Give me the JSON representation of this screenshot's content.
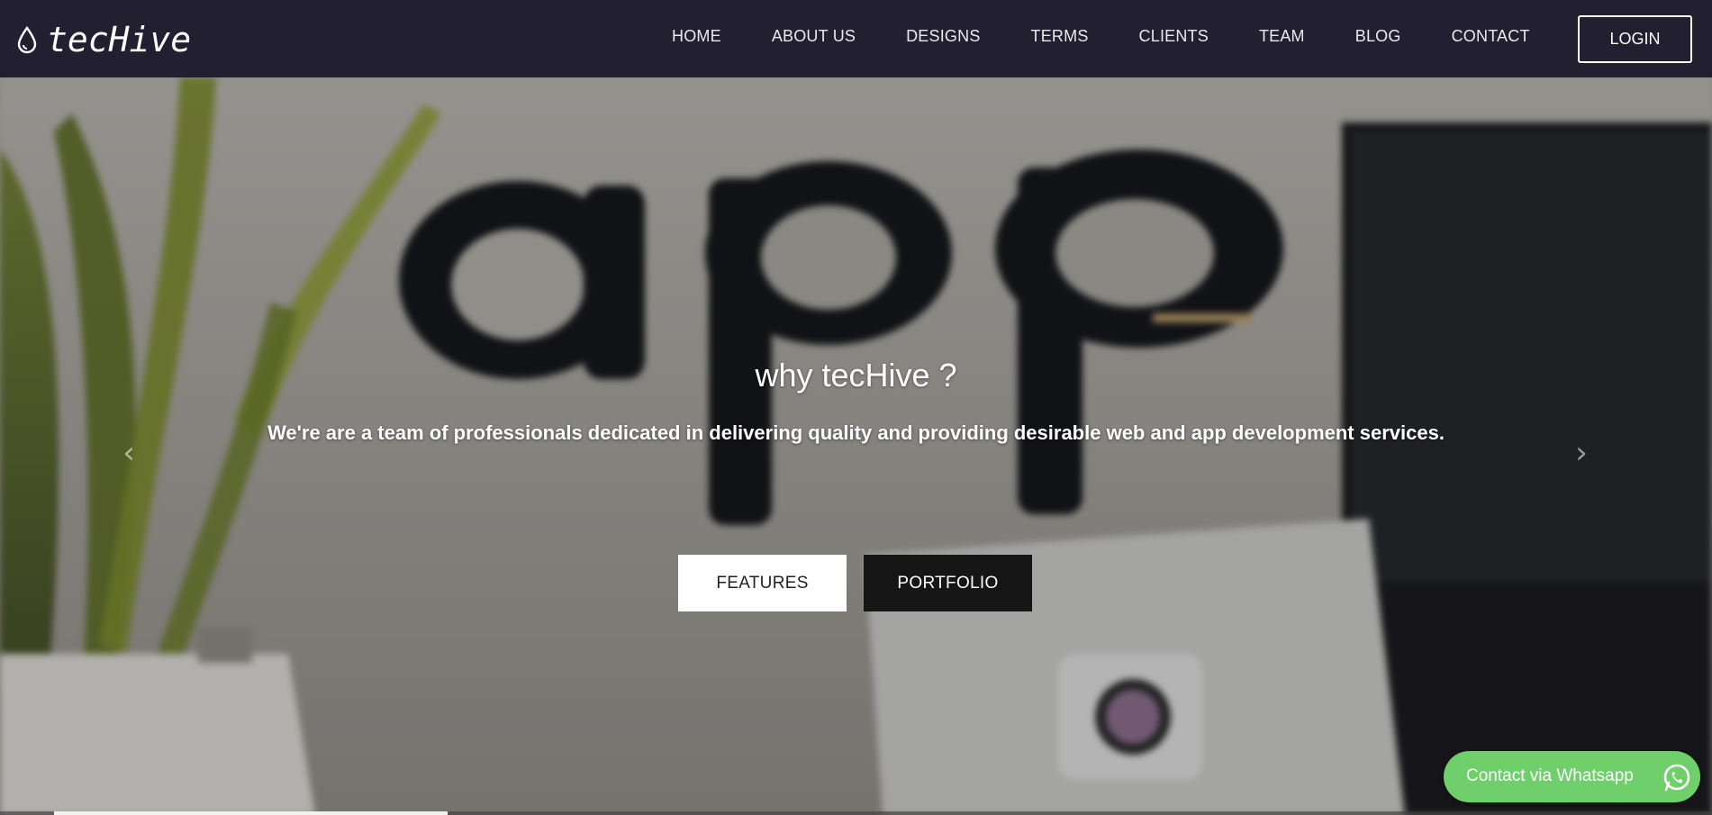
{
  "brand": {
    "name": "tecHive",
    "icon": "droplet-icon"
  },
  "nav": {
    "items": [
      {
        "label": "HOME"
      },
      {
        "label": "ABOUT US"
      },
      {
        "label": "DESIGNS"
      },
      {
        "label": "TERMS"
      },
      {
        "label": "CLIENTS"
      },
      {
        "label": "TEAM"
      },
      {
        "label": "BLOG"
      },
      {
        "label": "CONTACT"
      }
    ],
    "login_label": "LOGIN"
  },
  "hero": {
    "title": "why tecHive ?",
    "subtitle": "We're are a team of professionals dedicated in delivering quality and providing desirable web and app development services.",
    "features_label": "FEATURES",
    "portfolio_label": "PORTFOLIO",
    "prev_icon": "chevron-left-icon",
    "next_icon": "chevron-right-icon",
    "slide_progress": 0.23
  },
  "whatsapp": {
    "label": "Contact via Whatsapp",
    "icon": "whatsapp-icon",
    "color": "#6fcf6a"
  },
  "colors": {
    "navbar_bg": "#221f30",
    "portfolio_bg": "#161616",
    "features_bg": "#ffffff"
  }
}
